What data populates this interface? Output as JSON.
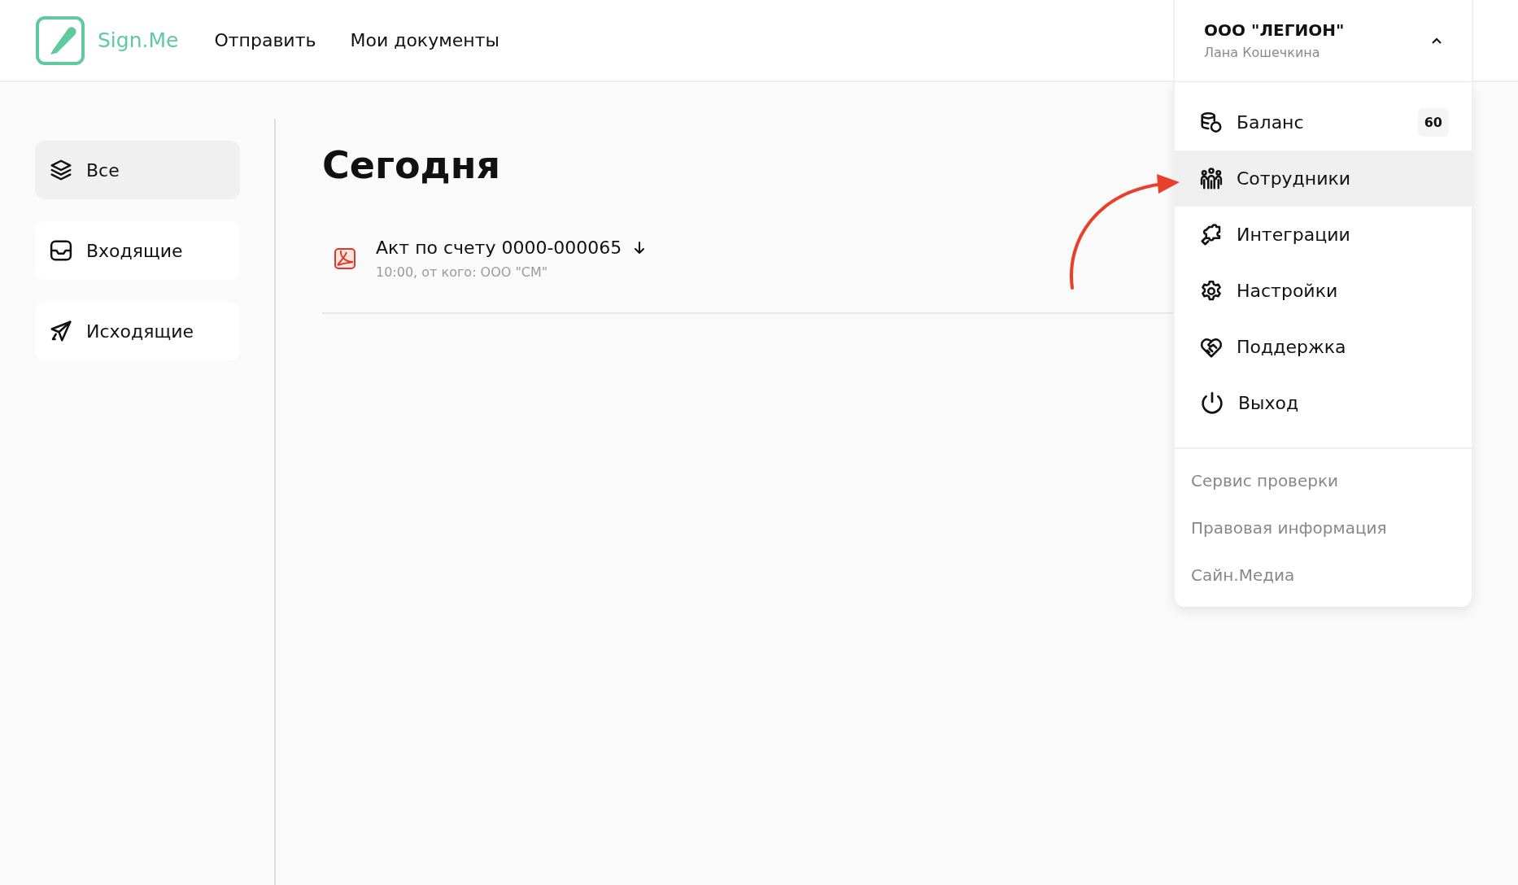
{
  "header": {
    "logo": {
      "text": "Sign.Me"
    },
    "nav": [
      {
        "label": "Отправить"
      },
      {
        "label": "Мои документы"
      }
    ],
    "account": {
      "company": "ООО \"ЛЕГИОН\"",
      "user": "Лана Кошечкина",
      "expanded": true,
      "menu": [
        {
          "label": "Баланс",
          "kind": "balance",
          "highlighted": false,
          "badge": "60"
        },
        {
          "label": "Сотрудники",
          "kind": "staff",
          "highlighted": true
        },
        {
          "label": "Интеграции",
          "kind": "integrations",
          "highlighted": false
        },
        {
          "label": "Настройки",
          "kind": "settings",
          "highlighted": false
        },
        {
          "label": "Поддержка",
          "kind": "support",
          "highlighted": false
        },
        {
          "label": "Выход",
          "kind": "logout",
          "highlighted": false
        }
      ],
      "links": [
        {
          "label": "Сервис проверки"
        },
        {
          "label": "Правовая информация"
        },
        {
          "label": "Сайн.Медиа"
        }
      ]
    }
  },
  "sidebar": {
    "items": [
      {
        "label": "Все",
        "kind": "all",
        "selected": true
      },
      {
        "label": "Входящие",
        "kind": "inbox",
        "selected": false
      },
      {
        "label": "Исходящие",
        "kind": "outbox",
        "selected": false
      }
    ]
  },
  "content": {
    "heading": "Сегодня",
    "documents": [
      {
        "title": "Акт по счету 0000-000065",
        "meta": "10:00, от кого: ООО \"СМ\"",
        "kind": "pdf"
      }
    ]
  },
  "annotations": [
    {
      "kind": "arrow"
    }
  ]
}
